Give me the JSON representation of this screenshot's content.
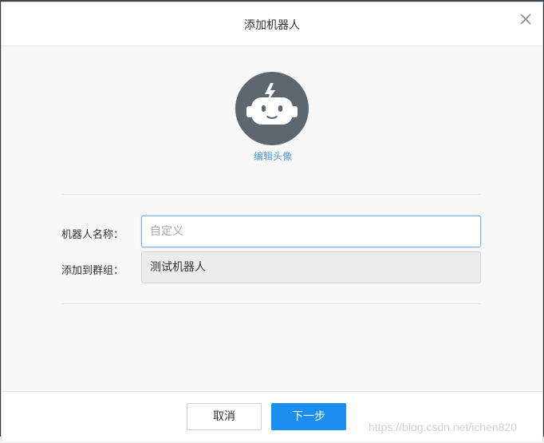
{
  "dialog": {
    "title": "添加机器人",
    "close_icon": "close-icon"
  },
  "avatar": {
    "icon": "robot-avatar-icon",
    "bg_color": "#5c6770",
    "edit_label": "编辑头像"
  },
  "form": {
    "name_label": "机器人名称：",
    "name_placeholder": "自定义",
    "name_value": "",
    "group_label": "添加到群组：",
    "group_value": "测试机器人"
  },
  "footer": {
    "cancel_label": "取消",
    "next_label": "下一步",
    "accent_color": "#1b8ef0"
  },
  "watermark": "https://blog.csdn.net/ichen820"
}
